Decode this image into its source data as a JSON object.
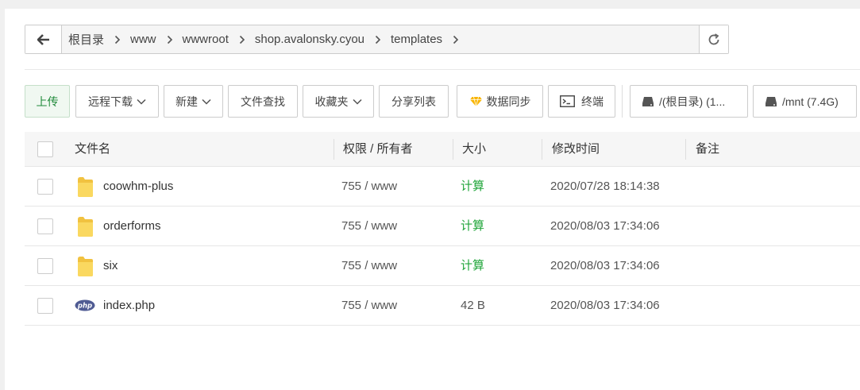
{
  "breadcrumb": {
    "items": [
      "根目录",
      "www",
      "wwwroot",
      "shop.avalonsky.cyou",
      "templates"
    ]
  },
  "toolbar": {
    "upload": "上传",
    "remote_download": "远程下载",
    "new": "新建",
    "file_search": "文件查找",
    "favorites": "收藏夹",
    "share_list": "分享列表",
    "sync": "数据同步",
    "terminal": "终端",
    "disk_root": "/(根目录) (1...",
    "disk_mnt": "/mnt (7.4G)"
  },
  "table": {
    "headers": {
      "name": "文件名",
      "perm": "权限 / 所有者",
      "size": "大小",
      "mtime": "修改时间",
      "note": "备注"
    },
    "rows": [
      {
        "name": "coowhm-plus",
        "type": "folder",
        "perm": "755 / www",
        "size": "计算",
        "mtime": "2020/07/28 18:14:38"
      },
      {
        "name": "orderforms",
        "type": "folder",
        "perm": "755 / www",
        "size": "计算",
        "mtime": "2020/08/03 17:34:06"
      },
      {
        "name": "six",
        "type": "folder",
        "perm": "755 / www",
        "size": "计算",
        "mtime": "2020/08/03 17:34:06"
      },
      {
        "name": "index.php",
        "type": "php",
        "perm": "755 / www",
        "size": "42 B",
        "mtime": "2020/08/03 17:34:06"
      }
    ]
  },
  "colors": {
    "accent_green": "#20a53a",
    "folder_yellow": "#f5cd52",
    "php_blue": "#4f5b93"
  }
}
